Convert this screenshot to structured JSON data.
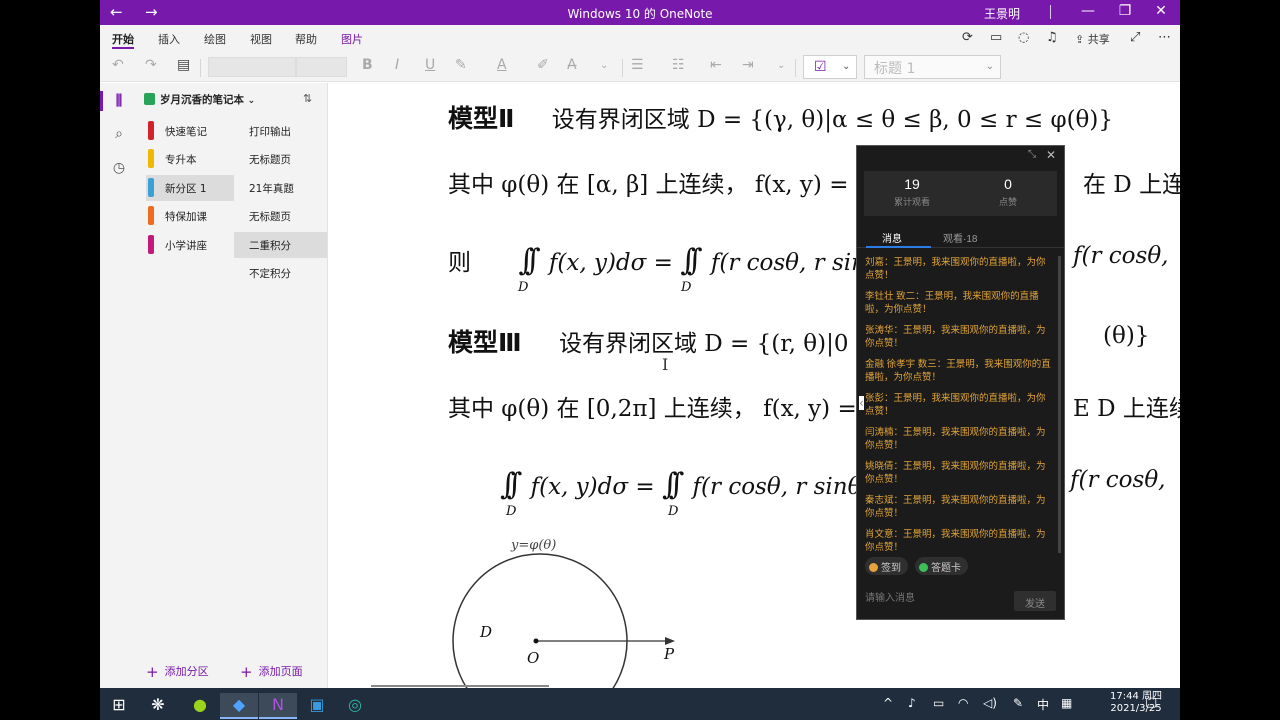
{
  "titlebar": {
    "title": "Windows 10 的 OneNote",
    "user": "王景明",
    "back": "←",
    "forward": "→",
    "minimize": "—",
    "restore": "❐",
    "close": "✕"
  },
  "ribbon": {
    "tabs": [
      "开始",
      "插入",
      "绘图",
      "视图",
      "帮助",
      "图片"
    ],
    "share_label": "共享",
    "style_value": "标题 1"
  },
  "notebook": {
    "name": "岁月沉香的笔记本",
    "sections": [
      {
        "label": "快速笔记",
        "color": "#d1232a"
      },
      {
        "label": "专升本",
        "color": "#f0b900"
      },
      {
        "label": "新分区 1",
        "color": "#3aa0d6"
      },
      {
        "label": "特保加课",
        "color": "#ef6b1f"
      },
      {
        "label": "小学讲座",
        "color": "#c2197c"
      }
    ],
    "pages": [
      "打印输出",
      "无标题页",
      "21年真题",
      "无标题页",
      "二重积分",
      "不定积分"
    ],
    "add_section": "添加分区",
    "add_page": "添加页面"
  },
  "content": {
    "model2_title": "模型Ⅱ",
    "model2_text": "设有界闭区域 D = {(γ, θ)|α ≤ θ ≤ β, 0 ≤ r ≤ φ(θ)}",
    "line2": "其中 φ(θ) 在 [α, β] 上连续， f(x, y) =",
    "line2_tail": "在 D 上连续",
    "line3_prefix": "则",
    "line3": "f(x, y)dσ = ",
    "line3b": "f(r cosθ, r sin",
    "line3_tail": "f(r cosθ,",
    "model3_title": "模型Ⅲ",
    "model3_text": "设有界闭区域 D = {(r, θ)|0",
    "model3_tail": "(θ)}",
    "line5": "其中 φ(θ) 在 [0,2π] 上连续， f(x, y) =",
    "line5_tail": "E D 上连续",
    "line6": "f(x, y)dσ = ",
    "line6b": "f(r cosθ, r sinθ",
    "line6_tail": "f(r cosθ,",
    "sub_D": "D",
    "fig_curve": "y=φ(θ)",
    "fig_D": "D",
    "fig_O": "O",
    "fig_P": "P"
  },
  "live": {
    "viewers_total": "19",
    "viewers_label": "累计观看",
    "likes": "0",
    "likes_label": "点赞",
    "tab_messages": "消息",
    "tab_viewers": "观看·18",
    "messages": [
      "刘嘉：王景明，我来围观你的直播啦，为你点赞！",
      "李钍壮 致二：王景明，我来围观你的直播啦，为你点赞！",
      "张涛华：王景明，我来围观你的直播啦，为你点赞！",
      "金融 徐孝宇 数三：王景明，我来围观你的直播啦，为你点赞！",
      "张彭：王景明，我来围观你的直播啦，为你点赞！",
      "闫涛楠：王景明，我来围观你的直播啦，为你点赞！",
      "姚晓倩：王景明，我来围观你的直播啦，为你点赞！",
      "秦志斌：王景明，我来围观你的直播啦，为你点赞！",
      "肖文意：王景明，我来围观你的直播啦，为你点赞！"
    ],
    "signin_label": "签到",
    "answercard_label": "答题卡",
    "input_placeholder": "请输入消息",
    "send_label": "发送"
  },
  "taskbar": {
    "ime": "中",
    "time": "17:44 周四",
    "date": "2021/3/25"
  }
}
